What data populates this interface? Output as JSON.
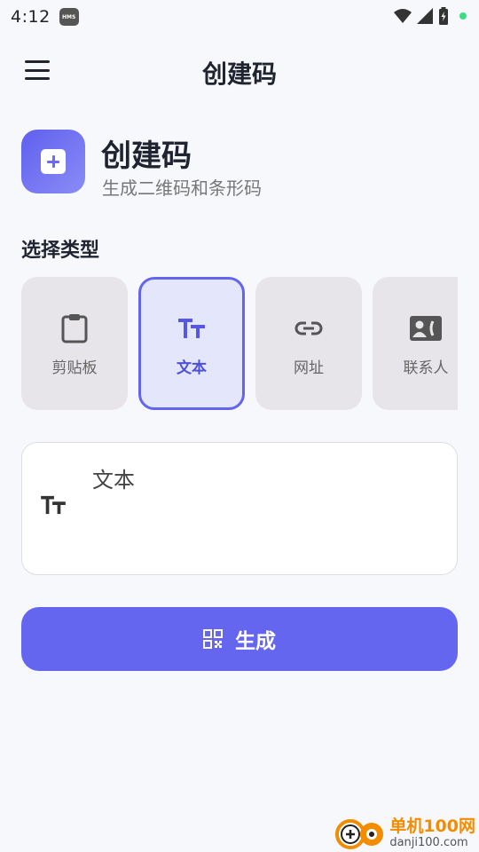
{
  "status_bar": {
    "time": "4:12",
    "badge": "HMS"
  },
  "app_bar": {
    "title": "创建码"
  },
  "header": {
    "title": "创建码",
    "subtitle": "生成二维码和条形码"
  },
  "section_label": "选择类型",
  "types": [
    {
      "label": "剪贴板",
      "icon": "clipboard-icon",
      "selected": false
    },
    {
      "label": "文本",
      "icon": "text-icon",
      "selected": true
    },
    {
      "label": "网址",
      "icon": "link-icon",
      "selected": false
    },
    {
      "label": "联系人",
      "icon": "contact-icon",
      "selected": false
    }
  ],
  "input": {
    "label": "文本",
    "icon": "text-icon"
  },
  "generate_button": {
    "label": "生成",
    "icon": "qr-code-icon"
  },
  "watermark": {
    "line1": "单机100网",
    "line2": "danji100.com"
  },
  "colors": {
    "accent": "#6466ef",
    "card_bg": "#e7e4ea",
    "selected_bg": "#e4e6fb",
    "background": "#f7f8fc"
  }
}
